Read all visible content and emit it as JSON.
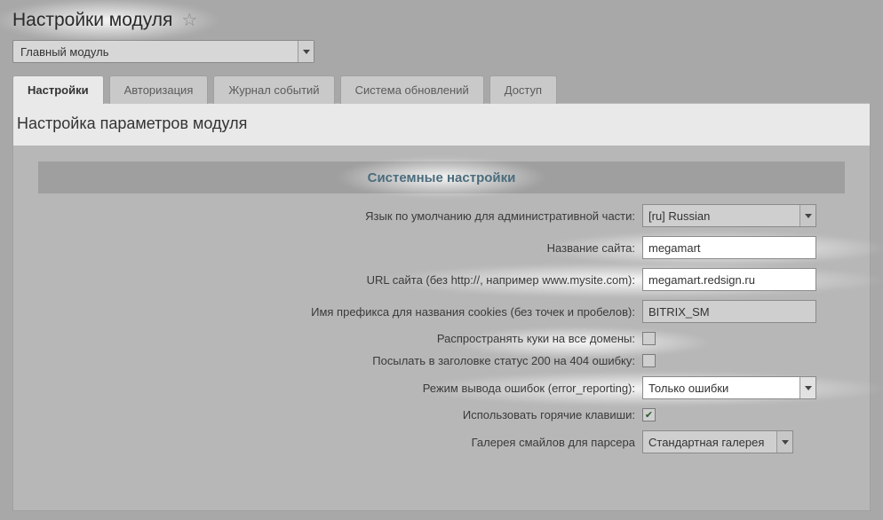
{
  "page": {
    "title": "Настройки модуля"
  },
  "moduleSelect": {
    "value": "Главный модуль"
  },
  "tabs": [
    {
      "label": "Настройки",
      "active": true
    },
    {
      "label": "Авторизация",
      "active": false
    },
    {
      "label": "Журнал событий",
      "active": false
    },
    {
      "label": "Система обновлений",
      "active": false
    },
    {
      "label": "Доступ",
      "active": false
    }
  ],
  "panel": {
    "title": "Настройка параметров модуля",
    "section": "Системные настройки"
  },
  "fields": {
    "adminLang": {
      "label": "Язык по умолчанию для административной части:",
      "value": "[ru] Russian"
    },
    "siteName": {
      "label": "Название сайта:",
      "value": "megamart"
    },
    "siteUrl": {
      "label": "URL сайта (без http://, например www.mysite.com):",
      "value": "megamart.redsign.ru"
    },
    "cookiePrefix": {
      "label": "Имя префикса для названия cookies (без точек и пробелов):",
      "value": "BITRIX_SM"
    },
    "spreadCookies": {
      "label": "Распространять куки на все домены:",
      "checked": false
    },
    "send200on404": {
      "label": "Посылать в заголовке статус 200 на 404 ошибку:",
      "checked": false
    },
    "errorReporting": {
      "label": "Режим вывода ошибок (error_reporting):",
      "value": "Только ошибки"
    },
    "hotkeys": {
      "label": "Использовать горячие клавиши:",
      "checked": true
    },
    "smileGallery": {
      "label": "Галерея смайлов для парсера",
      "value": "Стандартная галерея"
    }
  }
}
